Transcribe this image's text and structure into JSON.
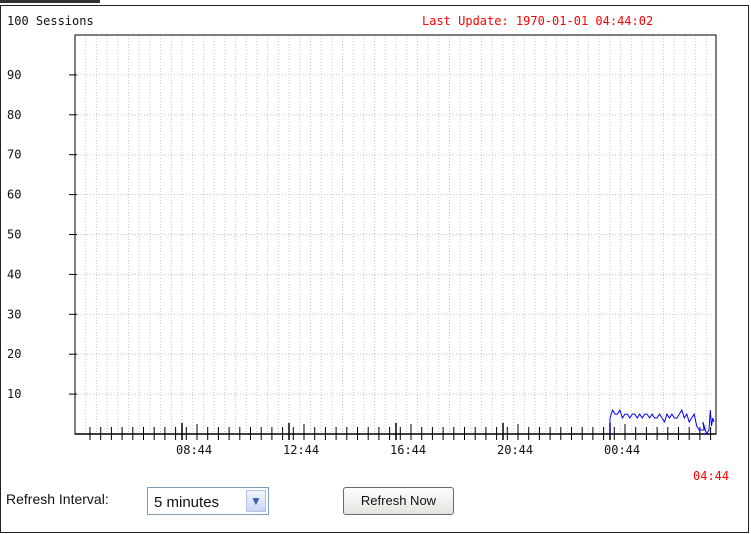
{
  "chart_data": {
    "type": "line",
    "title": "100 Sessions",
    "last_update": "Last Update: 1970-01-01 04:44:02",
    "ylim": [
      0,
      100
    ],
    "y_ticks": [
      "10",
      "20",
      "30",
      "40",
      "50",
      "60",
      "70",
      "80",
      "90"
    ],
    "x_tick_labels": [
      "08:44",
      "12:44",
      "16:44",
      "20:44",
      "00:44"
    ],
    "current_time_label": "04:44",
    "grid": true,
    "series": [
      {
        "color": "#0000ff",
        "x": [
          0.0,
          0.1,
          0.2,
          0.3,
          0.4,
          0.5,
          0.6,
          0.7,
          0.8,
          0.9,
          1.0,
          1.1,
          1.2,
          1.3,
          1.4,
          1.5,
          1.6,
          1.7,
          1.8,
          1.9,
          2.0,
          2.1,
          2.2,
          2.3,
          2.4,
          2.5,
          2.6,
          2.7,
          2.8,
          2.9,
          3.0,
          3.1,
          3.2,
          3.3,
          3.4,
          3.5,
          3.6,
          3.7,
          3.8,
          3.75,
          3.9,
          4.0,
          4.05,
          4.1,
          4.15,
          4.2
        ],
        "y": [
          4,
          6,
          5,
          5,
          6,
          4,
          5,
          5,
          4,
          5,
          5,
          4,
          5,
          4,
          5,
          5,
          4,
          5,
          4,
          4,
          5,
          4,
          3,
          5,
          4,
          5,
          4,
          4,
          5,
          6,
          4,
          5,
          3,
          4,
          5,
          2,
          1,
          1,
          1,
          3,
          0,
          1,
          6,
          2,
          4,
          3
        ]
      }
    ]
  },
  "controls": {
    "refresh_interval_label": "Refresh Interval:",
    "interval_value": "5 minutes",
    "refresh_button": "Refresh Now"
  },
  "colors": {
    "line": "#0000ff",
    "highlight": "#ff0000",
    "grid": "#c8c8c8"
  }
}
